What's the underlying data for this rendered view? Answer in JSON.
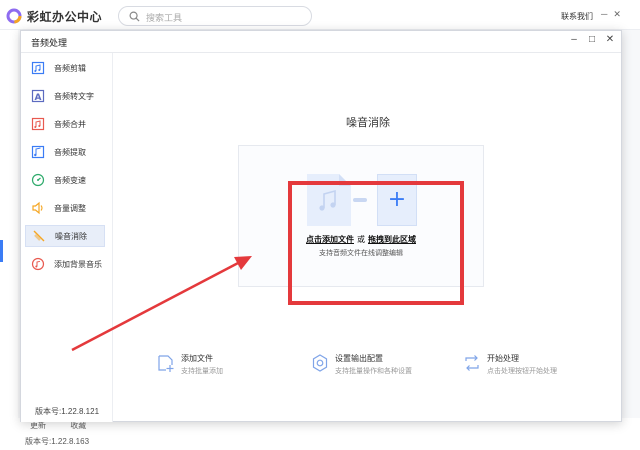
{
  "app": {
    "name": "彩虹办公中心",
    "search_placeholder": "搜索工具",
    "contact": "联系我们",
    "footer_links": [
      "更新",
      "收藏"
    ],
    "version": "版本号:1.22.8.163"
  },
  "dialog": {
    "title": "音频处理",
    "version": "版本号:1.22.8.121",
    "sidebar": [
      {
        "label": "音频剪辑",
        "icon": "audio-cut-icon",
        "color": "#3b7cf5"
      },
      {
        "label": "音频转文字",
        "icon": "audio-to-text-icon",
        "color": "#5c6bc0"
      },
      {
        "label": "音频合并",
        "icon": "audio-merge-icon",
        "color": "#e8594f"
      },
      {
        "label": "音频提取",
        "icon": "audio-extract-icon",
        "color": "#3b7cf5"
      },
      {
        "label": "音频变速",
        "icon": "audio-speed-icon",
        "color": "#2eaa6b"
      },
      {
        "label": "音量调整",
        "icon": "volume-adjust-icon",
        "color": "#f5a623"
      },
      {
        "label": "噪音消除",
        "icon": "noise-removal-icon",
        "color": "#f5a623",
        "active": true
      },
      {
        "label": "添加背景音乐",
        "icon": "add-bg-music-icon",
        "color": "#e8594f"
      }
    ],
    "main": {
      "heading": "噪音消除",
      "drop_click": "点击添加文件",
      "drop_or": "或",
      "drop_drag": "拖拽到此区域",
      "drop_hint": "支持音频文件在线调整编辑",
      "actions": [
        {
          "title": "添加文件",
          "desc": "支持批量添加",
          "icon": "add-file-icon"
        },
        {
          "title": "设置输出配置",
          "desc": "支持批量操作和各种设置",
          "icon": "settings-gear-icon"
        },
        {
          "title": "开始处理",
          "desc": "点击处理按钮开始处理",
          "icon": "process-arrows-icon"
        }
      ]
    }
  },
  "colors": {
    "accent": "#3b7cf5",
    "highlight": "#e4393c"
  }
}
